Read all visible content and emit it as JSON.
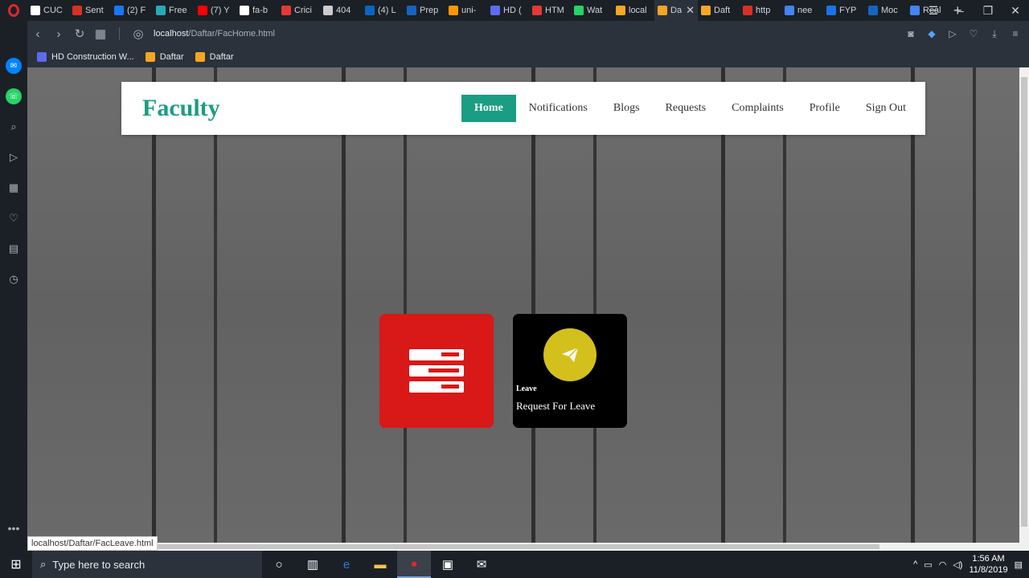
{
  "browser": {
    "tabs": [
      {
        "label": "CUC",
        "color": "#ffffff"
      },
      {
        "label": "Sent",
        "color": "#d93025"
      },
      {
        "label": "(2) F",
        "color": "#1877f2"
      },
      {
        "label": "Free",
        "color": "#2aa8b7"
      },
      {
        "label": "(7) Y",
        "color": "#ff0000"
      },
      {
        "label": "fa-b",
        "color": "#ffffff"
      },
      {
        "label": "Crici",
        "color": "#e53935"
      },
      {
        "label": "404",
        "color": "#cccccc"
      },
      {
        "label": "(4) L",
        "color": "#0a66c2"
      },
      {
        "label": "Prep",
        "color": "#1565c0"
      },
      {
        "label": "uni-",
        "color": "#ff9800"
      },
      {
        "label": "HD (",
        "color": "#5b6cf0"
      },
      {
        "label": "HTM",
        "color": "#e53935"
      },
      {
        "label": "Wat",
        "color": "#25d366"
      },
      {
        "label": "local",
        "color": "#f6a623"
      },
      {
        "label": "Da",
        "color": "#f6a623",
        "active": true
      },
      {
        "label": "Daft",
        "color": "#f6a623"
      },
      {
        "label": "http",
        "color": "#d93025"
      },
      {
        "label": "nee",
        "color": "#4285f4"
      },
      {
        "label": "FYP",
        "color": "#1a73e8"
      },
      {
        "label": "Moc",
        "color": "#1565c0"
      },
      {
        "label": "Real",
        "color": "#4285f4"
      }
    ],
    "url_host": "localhost",
    "url_path": "/Daftar/FacHome.html",
    "bookmarks": [
      {
        "label": "HD Construction W...",
        "color": "#5b6cf0"
      },
      {
        "label": "Daftar",
        "color": "#f6a623"
      },
      {
        "label": "Daftar",
        "color": "#f6a623"
      }
    ],
    "status_url": "localhost/Daftar/FacLeave.html"
  },
  "page": {
    "brand": "Faculty",
    "nav": [
      {
        "label": "Home",
        "active": true
      },
      {
        "label": "Notifications"
      },
      {
        "label": "Blogs"
      },
      {
        "label": "Requests"
      },
      {
        "label": "Complaints"
      },
      {
        "label": "Profile"
      },
      {
        "label": "Sign Out"
      }
    ],
    "cards": [
      {
        "icon": "form-icon",
        "color": "#d91818"
      },
      {
        "icon": "send-icon",
        "color": "#000000",
        "accent": "#d4c01c",
        "label": "Leave",
        "title": "Request For Leave"
      }
    ]
  },
  "taskbar": {
    "search_placeholder": "Type here to search",
    "time": "1:56 AM",
    "date": "11/8/2019"
  }
}
